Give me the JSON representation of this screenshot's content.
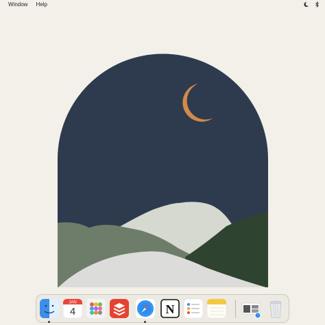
{
  "menubar": {
    "items": [
      "Window",
      "Help"
    ]
  },
  "dock": {
    "apps": [
      {
        "name": "Finder",
        "icon": "finder-icon",
        "running": true
      },
      {
        "name": "Calendar",
        "icon": "calendar-icon",
        "month": "JAN",
        "day": "4",
        "running": false
      },
      {
        "name": "Launchpad",
        "icon": "launchpad-icon",
        "running": false
      },
      {
        "name": "Todoist",
        "icon": "todoist-icon",
        "running": false
      },
      {
        "name": "Safari",
        "icon": "safari-icon",
        "running": true
      },
      {
        "name": "Notion",
        "icon": "notion-icon",
        "letter": "N",
        "running": false
      },
      {
        "name": "Reminders",
        "icon": "reminders-icon",
        "running": false
      },
      {
        "name": "Notes",
        "icon": "notes-icon",
        "running": false
      },
      {
        "name": "Minimized Window",
        "icon": "minimized-window-icon",
        "running": false
      },
      {
        "name": "Trash",
        "icon": "trash-icon",
        "running": false
      }
    ]
  },
  "colors": {
    "background": "#f2f0e8",
    "night_sky": "#2e3a4e",
    "moon": "#d08a4a",
    "mountain_light": "#d6d9cf",
    "mountain_sage": "#6e7c6a",
    "mountain_dark": "#2e4430",
    "snow": "#dcdddb"
  }
}
